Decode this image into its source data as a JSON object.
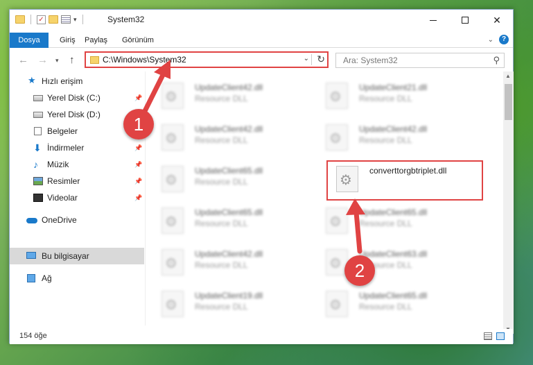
{
  "window": {
    "title": "System32",
    "colors": {
      "accent": "#1979ca",
      "highlight": "#e04343"
    }
  },
  "ribbon": {
    "tabs": [
      "Dosya",
      "Giriş",
      "Paylaş",
      "Görünüm"
    ]
  },
  "address": {
    "path": "C:\\Windows\\System32"
  },
  "search": {
    "placeholder": "Ara: System32"
  },
  "sidebar": {
    "items": [
      {
        "label": "Hızlı erişim",
        "icon": "star-icon"
      },
      {
        "label": "Yerel Disk (C:)",
        "icon": "drive-icon",
        "pinned": true
      },
      {
        "label": "Yerel Disk (D:)",
        "icon": "drive-icon"
      },
      {
        "label": "Belgeler",
        "icon": "documents-icon"
      },
      {
        "label": "İndirmeler",
        "icon": "download-icon",
        "pinned": true
      },
      {
        "label": "Müzik",
        "icon": "music-icon",
        "pinned": true
      },
      {
        "label": "Resimler",
        "icon": "pictures-icon",
        "pinned": true
      },
      {
        "label": "Videolar",
        "icon": "videos-icon",
        "pinned": true
      },
      {
        "label": "OneDrive",
        "icon": "cloud-icon"
      },
      {
        "label": "Bu bilgisayar",
        "icon": "computer-icon",
        "selected": true
      },
      {
        "label": "Ağ",
        "icon": "network-icon"
      }
    ]
  },
  "files": [
    {
      "name": "UpdateClient42.dll",
      "type": "Resource DLL"
    },
    {
      "name": "UpdateClient21.dll",
      "type": "Resource DLL"
    },
    {
      "name": "UpdateClient42.dll",
      "type": "Resource DLL"
    },
    {
      "name": "UpdateClient42.dll",
      "type": "Resource DLL"
    },
    {
      "name": "UpdateClient65.dll",
      "type": "Resource DLL"
    },
    {
      "name": "converttorgbtriplet.dll",
      "type": ""
    },
    {
      "name": "UpdateClient65.dll",
      "type": "Resource DLL"
    },
    {
      "name": "UpdateClient65.dll",
      "type": "Resource DLL"
    },
    {
      "name": "UpdateClient42.dll",
      "type": "Resource DLL"
    },
    {
      "name": "UpdateClient63.dll",
      "type": "Resource DLL"
    },
    {
      "name": "UpdateClient19.dll",
      "type": "Resource DLL"
    },
    {
      "name": "UpdateClient65.dll",
      "type": "Resource DLL"
    }
  ],
  "status": {
    "count": "154 öğe"
  },
  "annotations": {
    "step1": "1",
    "step2": "2"
  }
}
